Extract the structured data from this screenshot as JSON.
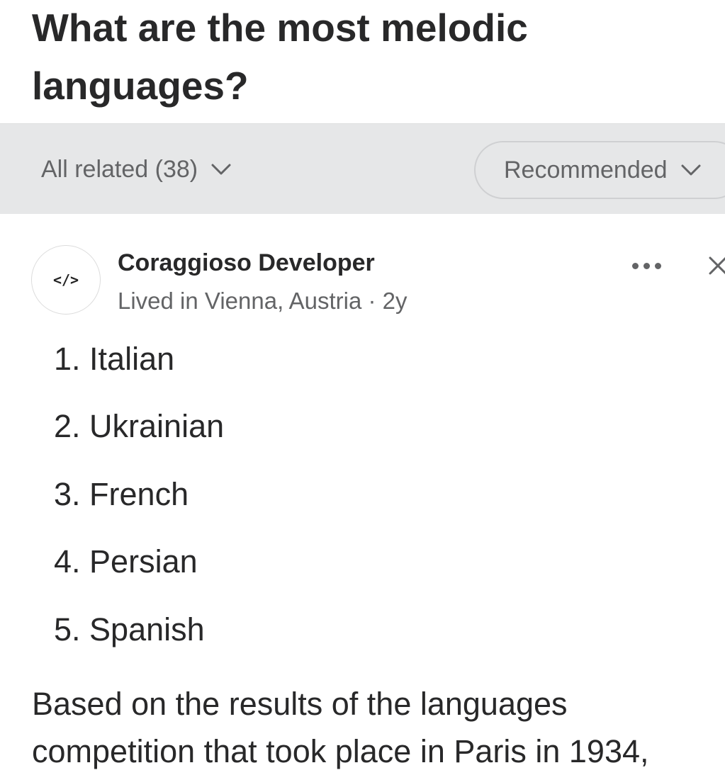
{
  "question": {
    "title": "What are the most melodic languages?"
  },
  "filters": {
    "all_related_label": "All related (38)",
    "sort_label": "Recommended"
  },
  "answer": {
    "avatar_text": "</>",
    "author_name": "Coraggioso Developer",
    "author_credential": "Lived in Vienna, Austria",
    "separator": "·",
    "age": "2y",
    "list_items": [
      {
        "number": "1.",
        "text": "Italian"
      },
      {
        "number": "2.",
        "text": "Ukrainian"
      },
      {
        "number": "3.",
        "text": "French"
      },
      {
        "number": "4.",
        "text": "Persian"
      },
      {
        "number": "5.",
        "text": "Spanish"
      }
    ],
    "paragraph": "Based on the results of the languages competition that took place in Paris in 1934,"
  },
  "icons": {
    "filter_chevron": "chevron-down-icon",
    "sort_chevron": "chevron-down-icon",
    "more": "more-options-icon",
    "close": "close-icon"
  },
  "colors": {
    "text_primary": "#282829",
    "text_secondary": "#636466",
    "filter_bar_bg": "#e6e7e8",
    "pill_border": "#cfd0d2"
  }
}
